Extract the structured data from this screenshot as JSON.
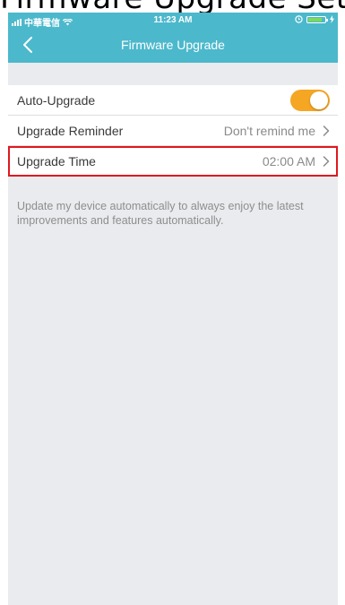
{
  "caption": {
    "text": "Firmware Upgrade Settings: Upgrade Time"
  },
  "status_bar": {
    "carrier": "中華電信",
    "time": "11:23 AM",
    "battery_level": 0.85
  },
  "navbar": {
    "title": "Firmware Upgrade",
    "back_icon": "chevron-left-icon",
    "color": "#4cb8cc"
  },
  "settings": {
    "auto_upgrade": {
      "label": "Auto-Upgrade",
      "enabled": true,
      "toggle_color": "#f5a623"
    },
    "upgrade_reminder": {
      "label": "Upgrade Reminder",
      "value": "Don't remind me"
    },
    "upgrade_time": {
      "label": "Upgrade Time",
      "value": "02:00 AM",
      "highlight_color": "#e0181f"
    }
  },
  "description": "Update my device automatically to always enjoy the latest improvements and features automatically."
}
